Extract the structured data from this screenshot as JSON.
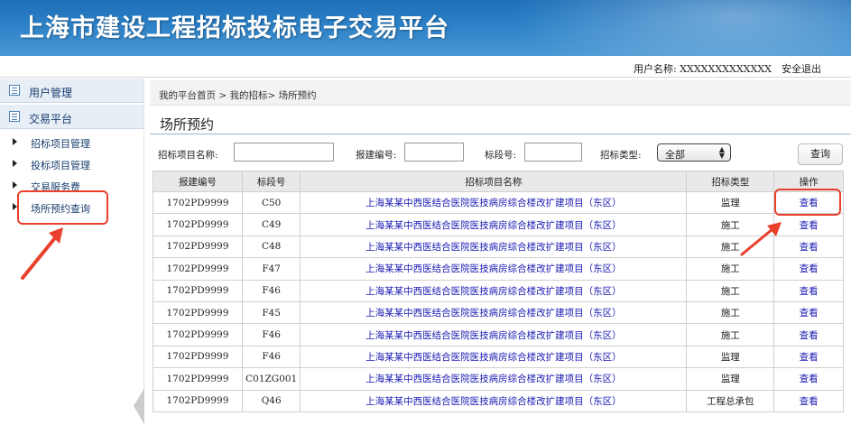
{
  "header": {
    "title": "上海市建设工程招标投标电子交易平台"
  },
  "userbar": {
    "username_label": "用户名称:  XXXXXXXXXXXXX",
    "logout_label": "安全退出"
  },
  "sidebar": {
    "sections": [
      {
        "label": "用户管理"
      },
      {
        "label": "交易平台"
      }
    ],
    "items": [
      {
        "label": "招标项目管理"
      },
      {
        "label": "投标项目管理"
      },
      {
        "label": "交易服务费"
      },
      {
        "label": "场所预约查询"
      }
    ]
  },
  "breadcrumb": "我的平台首页 > 我的招标> 场所预约",
  "page_title": "场所预约",
  "filters": {
    "project_name_label": "招标项目名称:",
    "project_name_value": "",
    "report_no_label": "报建编号:",
    "report_no_value": "",
    "section_no_label": "标段号:",
    "section_no_value": "",
    "bid_type_label": "招标类型:",
    "bid_type_value": "全部",
    "search_button": "查询"
  },
  "table": {
    "headers": [
      "报建编号",
      "标段号",
      "招标项目名称",
      "招标类型",
      "操作"
    ],
    "rows": [
      {
        "report_no": "1702PD9999",
        "section": "C50",
        "project": "上海某某中西医结合医院医技病房综合楼改扩建项目（东区）",
        "type": "监理",
        "action": "查看"
      },
      {
        "report_no": "1702PD9999",
        "section": "C49",
        "project": "上海某某中西医结合医院医技病房综合楼改扩建项目（东区）",
        "type": "施工",
        "action": "查看"
      },
      {
        "report_no": "1702PD9999",
        "section": "C48",
        "project": "上海某某中西医结合医院医技病房综合楼改扩建项目（东区）",
        "type": "施工",
        "action": "查看"
      },
      {
        "report_no": "1702PD9999",
        "section": "F47",
        "project": "上海某某中西医结合医院医技病房综合楼改扩建项目（东区）",
        "type": "施工",
        "action": "查看"
      },
      {
        "report_no": "1702PD9999",
        "section": "F46",
        "project": "上海某某中西医结合医院医技病房综合楼改扩建项目（东区）",
        "type": "施工",
        "action": "查看"
      },
      {
        "report_no": "1702PD9999",
        "section": "F45",
        "project": "上海某某中西医结合医院医技病房综合楼改扩建项目（东区）",
        "type": "施工",
        "action": "查看"
      },
      {
        "report_no": "1702PD9999",
        "section": "F46",
        "project": "上海某某中西医结合医院医技病房综合楼改扩建项目（东区）",
        "type": "施工",
        "action": "查看"
      },
      {
        "report_no": "1702PD9999",
        "section": "F46",
        "project": "上海某某中西医结合医院医技病房综合楼改扩建项目（东区）",
        "type": "监理",
        "action": "查看"
      },
      {
        "report_no": "1702PD9999",
        "section": "C01ZG001",
        "project": "上海某某中西医结合医院医技病房综合楼改扩建项目（东区）",
        "type": "监理",
        "action": "查看"
      },
      {
        "report_no": "1702PD9999",
        "section": "Q46",
        "project": "上海某某中西医结合医院医技病房综合楼改扩建项目（东区）",
        "type": "工程总承包",
        "action": "查看"
      }
    ]
  },
  "colors": {
    "banner": "#2a7fc6",
    "link": "#1a1ab3",
    "annotation": "#e8402a"
  }
}
